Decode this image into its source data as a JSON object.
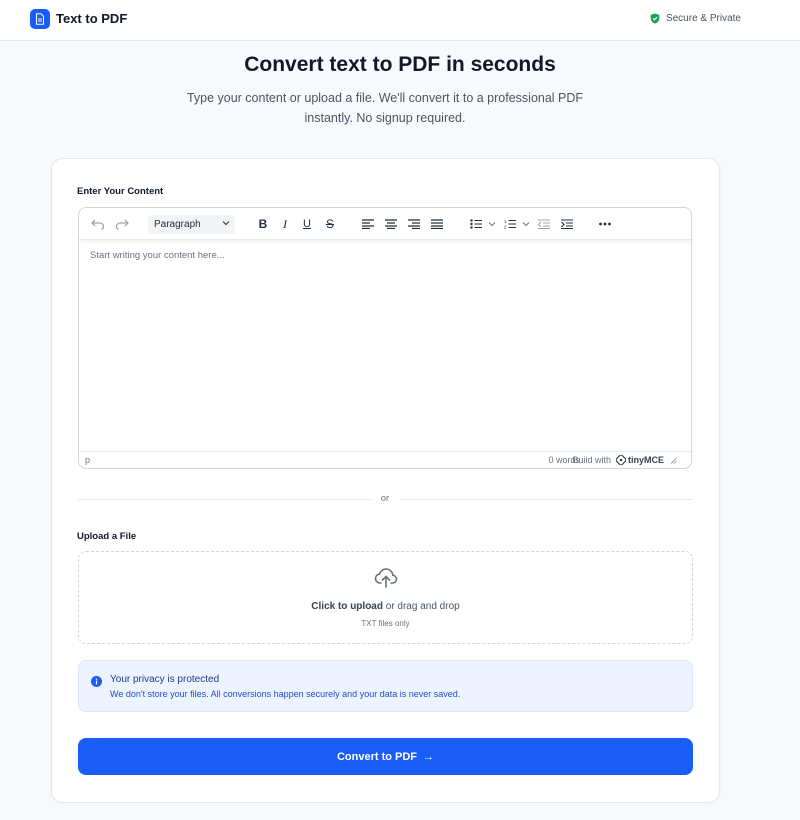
{
  "header": {
    "brand": "Text to PDF",
    "secure_label": "Secure & Private"
  },
  "hero": {
    "title": "Convert text to PDF in seconds",
    "subtitle": "Type your content or upload a file. We'll convert it to a professional PDF instantly. No signup required."
  },
  "editor": {
    "label": "Enter Your Content",
    "format_select": "Paragraph",
    "placeholder": "Start writing your content here...",
    "status_path": "p",
    "word_count": "0 words",
    "built_with": "Build with",
    "tiny_brand": "tinyMCE",
    "toolbar": {
      "undo_icon": "undo-icon",
      "redo_icon": "redo-icon",
      "bold": "B",
      "italic": "I",
      "underline": "U",
      "strikethrough": "S"
    }
  },
  "divider": {
    "text": "or"
  },
  "upload": {
    "label": "Upload a File",
    "click_text": "Click to upload",
    "drag_text": " or drag and drop",
    "hint": "TXT files only"
  },
  "privacy": {
    "title": "Your privacy is protected",
    "text": "We don't store your files. All conversions happen securely and your data is never saved."
  },
  "convert": {
    "label": "Convert to PDF",
    "arrow": "→"
  },
  "colors": {
    "accent": "#1a5cf6",
    "shield": "#16a34a",
    "privacy_bg": "#eef4ff"
  }
}
